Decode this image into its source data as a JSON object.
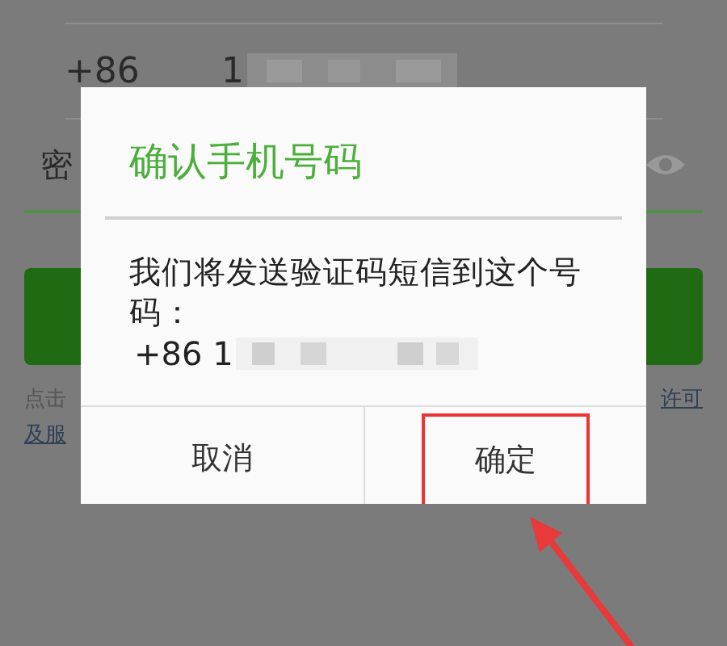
{
  "background": {
    "country_code": "+86",
    "phone_visible": "1",
    "password_label": "密",
    "agreement_start": "点击",
    "agreement_link": "许可",
    "agreement_second_line": "及服"
  },
  "dialog": {
    "title": "确认手机号码",
    "message": "我们将发送验证码短信到这个号码：",
    "phone": "+86 1",
    "buttons": [
      {
        "label": "取消",
        "highlighted": false
      },
      {
        "label": "确定",
        "highlighted": true
      }
    ]
  }
}
